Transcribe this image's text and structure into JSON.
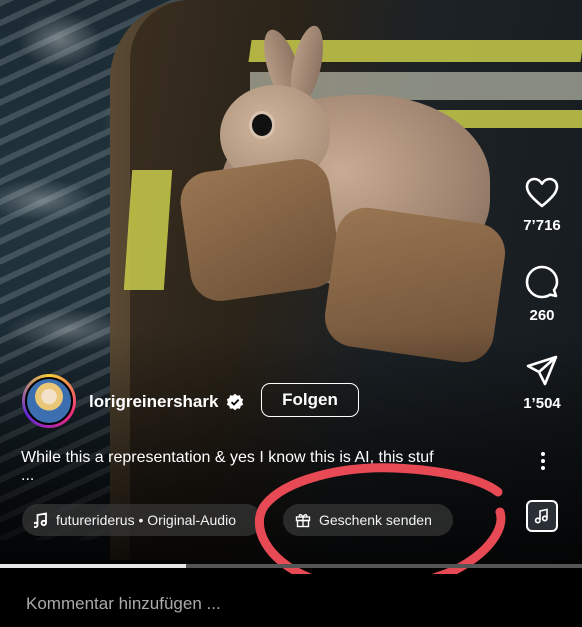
{
  "post": {
    "username": "lorigreinershark",
    "follow_label": "Folgen",
    "caption": "While this a representation & yes I know this is AI, this stuf",
    "caption_more": "...",
    "audio_label": "futureriderus • Original-Audio",
    "gift_label": "Geschenk senden"
  },
  "actions": {
    "likes": "7’716",
    "comments": "260",
    "shares": "1’504"
  },
  "comment": {
    "placeholder": "Kommentar hinzufügen ..."
  },
  "progress": {
    "fraction": 0.32
  },
  "icons": {
    "like": "heart-icon",
    "comment": "comment-bubble-icon",
    "share": "paper-plane-icon",
    "more": "more-vertical-icon",
    "audio": "music-note-icon",
    "gift": "gift-icon",
    "verified": "verified-badge-icon"
  },
  "colors": {
    "annotation": "#e84a55",
    "text": "#ffffff",
    "follow_border": "#ffffff"
  }
}
